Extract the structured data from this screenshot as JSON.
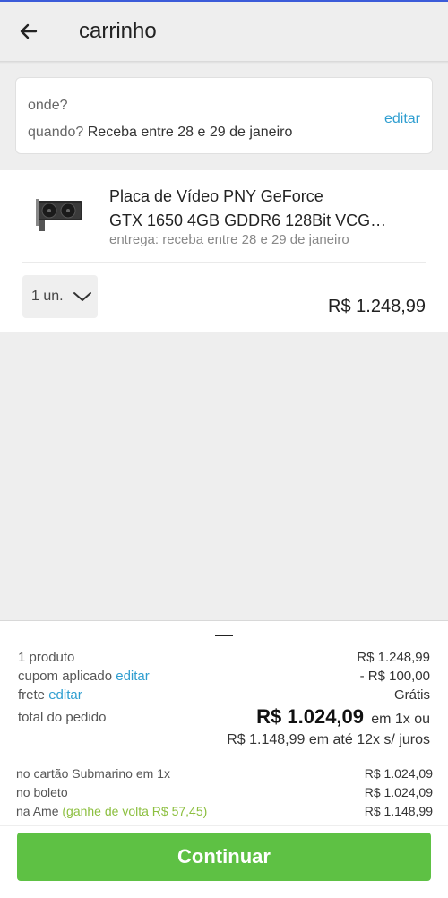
{
  "header": {
    "title": "carrinho",
    "back_icon": "arrow-left-icon"
  },
  "delivery": {
    "where_label": "onde?",
    "when_label": "quando?",
    "when_value": "Receba entre 28 e 29 de janeiro",
    "edit_label": "editar"
  },
  "product": {
    "name_line1": "Placa de Vídeo PNY GeForce",
    "name_line2": "GTX 1650 4GB GDDR6 128Bit VCG…",
    "delivery_text": "entrega: receba entre 28 e 29 de janeiro",
    "quantity_label": "1 un.",
    "price": "R$ 1.248,99"
  },
  "summary": {
    "products_label": "1 produto",
    "products_value": "R$ 1.248,99",
    "coupon_label": "cupom aplicado",
    "coupon_edit": "editar",
    "coupon_value": "- R$ 100,00",
    "shipping_label": "frete",
    "shipping_edit": "editar",
    "shipping_value": "Grátis",
    "total_label": "total do pedido",
    "total_value": "R$ 1.024,09",
    "total_suffix": "em 1x ou",
    "installment_text": "R$ 1.148,99 em até 12x s/ juros"
  },
  "payment_options": [
    {
      "label": "no cartão Submarino em 1x",
      "extra": "",
      "value": "R$ 1.024,09"
    },
    {
      "label": "no boleto",
      "extra": "",
      "value": "R$ 1.024,09"
    },
    {
      "label": "na Ame",
      "extra": "(ganhe de volta R$ 57,45)",
      "value": "R$ 1.148,99"
    }
  ],
  "continue_label": "Continuar",
  "colors": {
    "accent_link": "#2f9ed0",
    "discount_green": "#8cbf3f",
    "continue_green": "#5ec144"
  }
}
